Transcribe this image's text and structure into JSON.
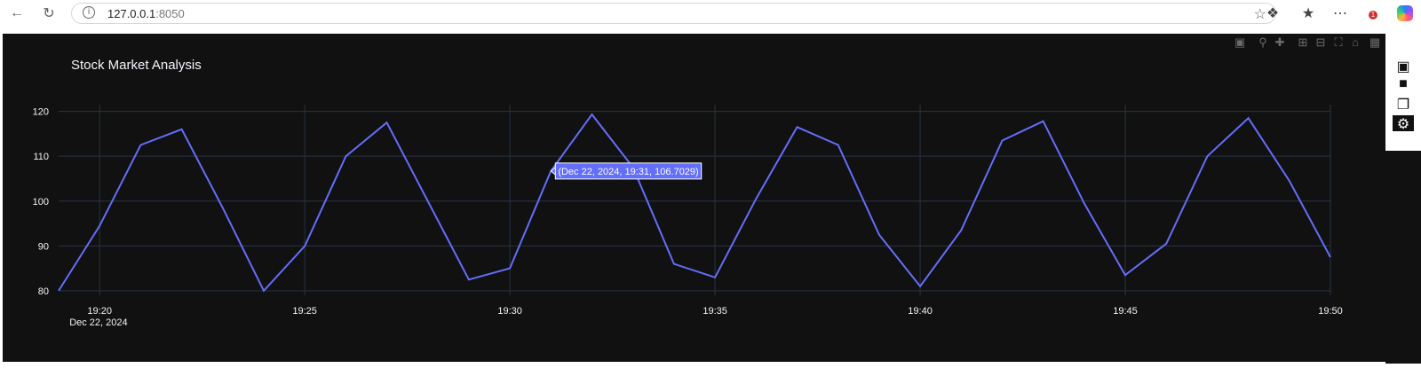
{
  "browser": {
    "url_host": "127.0.0.1",
    "url_port": ":8050",
    "icons": [
      "back-icon",
      "reload-icon",
      "info-icon",
      "star-icon",
      "extensions-icon",
      "favorites-icon",
      "more-icon",
      "copilot-icon"
    ],
    "notification_count": "1"
  },
  "modebar": {
    "icons": [
      "camera-icon",
      "zoom-icon",
      "pan-icon",
      "zoom-in-icon",
      "zoom-out-icon",
      "autoscale-icon",
      "reset-axes-icon",
      "plotly-logo-icon"
    ]
  },
  "sidebar": {
    "icons": [
      "camera-icon",
      "video-icon",
      "layers-icon",
      "gear-icon"
    ]
  },
  "colors": {
    "plot_bg": "#111111",
    "grid": "#283442",
    "line": "#636efa",
    "text": "#f2f5fa",
    "title": "#f2f5fa"
  },
  "chart_data": {
    "type": "line",
    "title": "Stock Market Analysis",
    "xlabel": "",
    "ylabel": "",
    "x": [
      "19:19",
      "19:20",
      "19:21",
      "19:22",
      "19:23",
      "19:24",
      "19:25",
      "19:26",
      "19:27",
      "19:28",
      "19:29",
      "19:30",
      "19:31",
      "19:32",
      "19:33",
      "19:34",
      "19:35",
      "19:36",
      "19:37",
      "19:38",
      "19:39",
      "19:40",
      "19:41",
      "19:42",
      "19:43",
      "19:44",
      "19:45",
      "19:46",
      "19:47",
      "19:48",
      "19:49",
      "19:50"
    ],
    "values": [
      80,
      94.5,
      112.5,
      116,
      98.5,
      80,
      90,
      110,
      117.5,
      100,
      82.5,
      85,
      106.7,
      119.3,
      107.5,
      86,
      83,
      100.5,
      116.5,
      112.5,
      92.5,
      81,
      93.5,
      113.5,
      117.8,
      99.5,
      83.5,
      90.5,
      110,
      118.5,
      104.5,
      87.5
    ],
    "x_ticks": [
      "19:20",
      "19:25",
      "19:30",
      "19:35",
      "19:40",
      "19:45",
      "19:50"
    ],
    "x_tick_date": "Dec 22, 2024",
    "y_ticks": [
      80,
      90,
      100,
      110,
      120
    ],
    "ylim": [
      79,
      121.5
    ],
    "grid": true,
    "hover": {
      "label": "(Dec 22, 2024, 19:31, 106.7029)"
    }
  }
}
